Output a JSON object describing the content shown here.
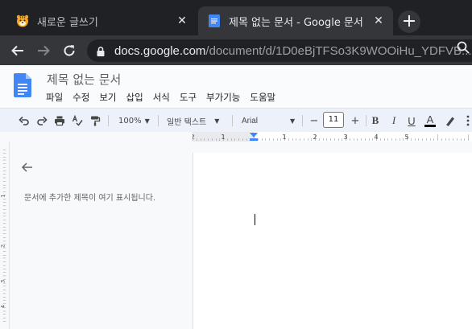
{
  "browser": {
    "tabs": [
      {
        "title": "새로운 글쓰기",
        "favicon": "tiger-emoji-icon",
        "active": false
      },
      {
        "title": "제목 없는 문서 - Google 문서",
        "favicon": "google-docs-icon",
        "active": true
      }
    ],
    "close_glyph": "✕",
    "new_tab_glyph": "+",
    "url_host": "docs.google.com",
    "url_path": "/document/d/1D0eBjTFSo3K9WOOiHu_YDFVB..."
  },
  "docs": {
    "title": "제목 없는 문서",
    "menu": [
      "파일",
      "수정",
      "보기",
      "삽입",
      "서식",
      "도구",
      "부가기능",
      "도움말"
    ]
  },
  "toolbar": {
    "zoom": "100%",
    "style": "일반 텍스트",
    "font": "Arial",
    "font_size": "11",
    "minus": "−",
    "plus": "+",
    "bold": "B",
    "italic": "I",
    "underline": "U",
    "text_color_letter": "A"
  },
  "ruler": {
    "marks": [
      "2",
      "1",
      "1",
      "2",
      "3",
      "4",
      "5"
    ]
  },
  "vruler": {
    "marks": [
      "1",
      "2",
      "3",
      "4"
    ]
  },
  "outline": {
    "placeholder": "문서에 추가한 제목이 여기 표시됩니다."
  },
  "colors": {
    "chrome_dark": "#202124",
    "chrome_tab": "#35363a",
    "docs_blue": "#4285f4",
    "toolbar_bg": "#edf2fa"
  }
}
